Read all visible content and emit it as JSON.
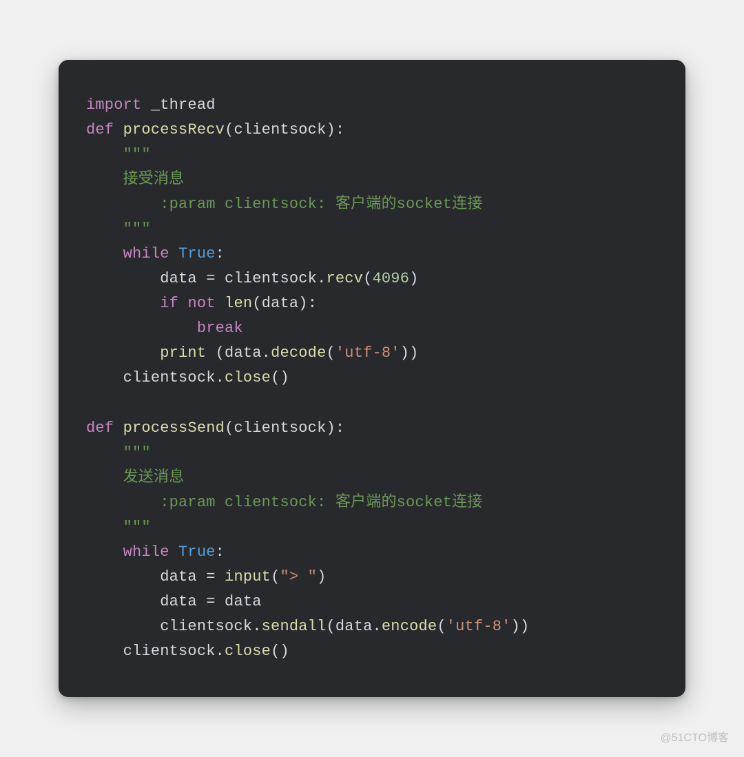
{
  "watermark": "@51CTO博客",
  "code": {
    "lines": [
      {
        "indent": 0,
        "tokens": [
          [
            "kw",
            "import"
          ],
          [
            "ident",
            " _thread"
          ]
        ]
      },
      {
        "indent": 0,
        "tokens": [
          [
            "kw",
            "def"
          ],
          [
            "ident",
            " "
          ],
          [
            "fn",
            "processRecv"
          ],
          [
            "punc",
            "("
          ],
          [
            "ident",
            "clientsock"
          ],
          [
            "punc",
            "):"
          ]
        ]
      },
      {
        "indent": 1,
        "tokens": [
          [
            "doc",
            "\"\"\""
          ]
        ]
      },
      {
        "indent": 1,
        "tokens": [
          [
            "doc",
            "接受消息"
          ]
        ]
      },
      {
        "indent": 2,
        "tokens": [
          [
            "doc",
            ":param clientsock: 客户端的socket连接"
          ]
        ]
      },
      {
        "indent": 1,
        "tokens": [
          [
            "doc",
            "\"\"\""
          ]
        ]
      },
      {
        "indent": 1,
        "tokens": [
          [
            "kw",
            "while"
          ],
          [
            "ident",
            " "
          ],
          [
            "const",
            "True"
          ],
          [
            "punc",
            ":"
          ]
        ]
      },
      {
        "indent": 2,
        "tokens": [
          [
            "ident",
            "data "
          ],
          [
            "punc",
            "="
          ],
          [
            "ident",
            " clientsock."
          ],
          [
            "call",
            "recv"
          ],
          [
            "punc",
            "("
          ],
          [
            "num",
            "4096"
          ],
          [
            "punc",
            ")"
          ]
        ]
      },
      {
        "indent": 2,
        "tokens": [
          [
            "kw",
            "if"
          ],
          [
            "ident",
            " "
          ],
          [
            "kw",
            "not"
          ],
          [
            "ident",
            " "
          ],
          [
            "builtin",
            "len"
          ],
          [
            "punc",
            "("
          ],
          [
            "ident",
            "data"
          ],
          [
            "punc",
            "):"
          ]
        ]
      },
      {
        "indent": 3,
        "tokens": [
          [
            "kw",
            "break"
          ]
        ]
      },
      {
        "indent": 2,
        "tokens": [
          [
            "builtin",
            "print"
          ],
          [
            "ident",
            " "
          ],
          [
            "punc",
            "("
          ],
          [
            "ident",
            "data."
          ],
          [
            "call",
            "decode"
          ],
          [
            "punc",
            "("
          ],
          [
            "str",
            "'utf-8'"
          ],
          [
            "punc",
            "))"
          ]
        ]
      },
      {
        "indent": 1,
        "tokens": [
          [
            "ident",
            "clientsock."
          ],
          [
            "call",
            "close"
          ],
          [
            "punc",
            "()"
          ]
        ]
      },
      {
        "indent": 0,
        "tokens": []
      },
      {
        "indent": 0,
        "tokens": [
          [
            "kw",
            "def"
          ],
          [
            "ident",
            " "
          ],
          [
            "fn",
            "processSend"
          ],
          [
            "punc",
            "("
          ],
          [
            "ident",
            "clientsock"
          ],
          [
            "punc",
            "):"
          ]
        ]
      },
      {
        "indent": 1,
        "tokens": [
          [
            "doc",
            "\"\"\""
          ]
        ]
      },
      {
        "indent": 1,
        "tokens": [
          [
            "doc",
            "发送消息"
          ]
        ]
      },
      {
        "indent": 2,
        "tokens": [
          [
            "doc",
            ":param clientsock: 客户端的socket连接"
          ]
        ]
      },
      {
        "indent": 1,
        "tokens": [
          [
            "doc",
            "\"\"\""
          ]
        ]
      },
      {
        "indent": 1,
        "tokens": [
          [
            "kw",
            "while"
          ],
          [
            "ident",
            " "
          ],
          [
            "const",
            "True"
          ],
          [
            "punc",
            ":"
          ]
        ]
      },
      {
        "indent": 2,
        "tokens": [
          [
            "ident",
            "data "
          ],
          [
            "punc",
            "="
          ],
          [
            "ident",
            " "
          ],
          [
            "builtin",
            "input"
          ],
          [
            "punc",
            "("
          ],
          [
            "str",
            "\"> \""
          ],
          [
            "punc",
            ")"
          ]
        ]
      },
      {
        "indent": 2,
        "tokens": [
          [
            "ident",
            "data "
          ],
          [
            "punc",
            "="
          ],
          [
            "ident",
            " data"
          ]
        ]
      },
      {
        "indent": 2,
        "tokens": [
          [
            "ident",
            "clientsock."
          ],
          [
            "call",
            "sendall"
          ],
          [
            "punc",
            "("
          ],
          [
            "ident",
            "data."
          ],
          [
            "call",
            "encode"
          ],
          [
            "punc",
            "("
          ],
          [
            "str",
            "'utf-8'"
          ],
          [
            "punc",
            "))"
          ]
        ]
      },
      {
        "indent": 1,
        "tokens": [
          [
            "ident",
            "clientsock."
          ],
          [
            "call",
            "close"
          ],
          [
            "punc",
            "()"
          ]
        ]
      }
    ],
    "indent_unit": "    "
  },
  "colors": {
    "background": "#f0f0f0",
    "card_bg": "#28292d",
    "keyword": "#c586c0",
    "function": "#dcdcaa",
    "constant": "#569cd6",
    "string": "#ce9178",
    "docstring": "#6a9955",
    "number": "#b5cea8",
    "default_text": "#d6d9dd"
  }
}
